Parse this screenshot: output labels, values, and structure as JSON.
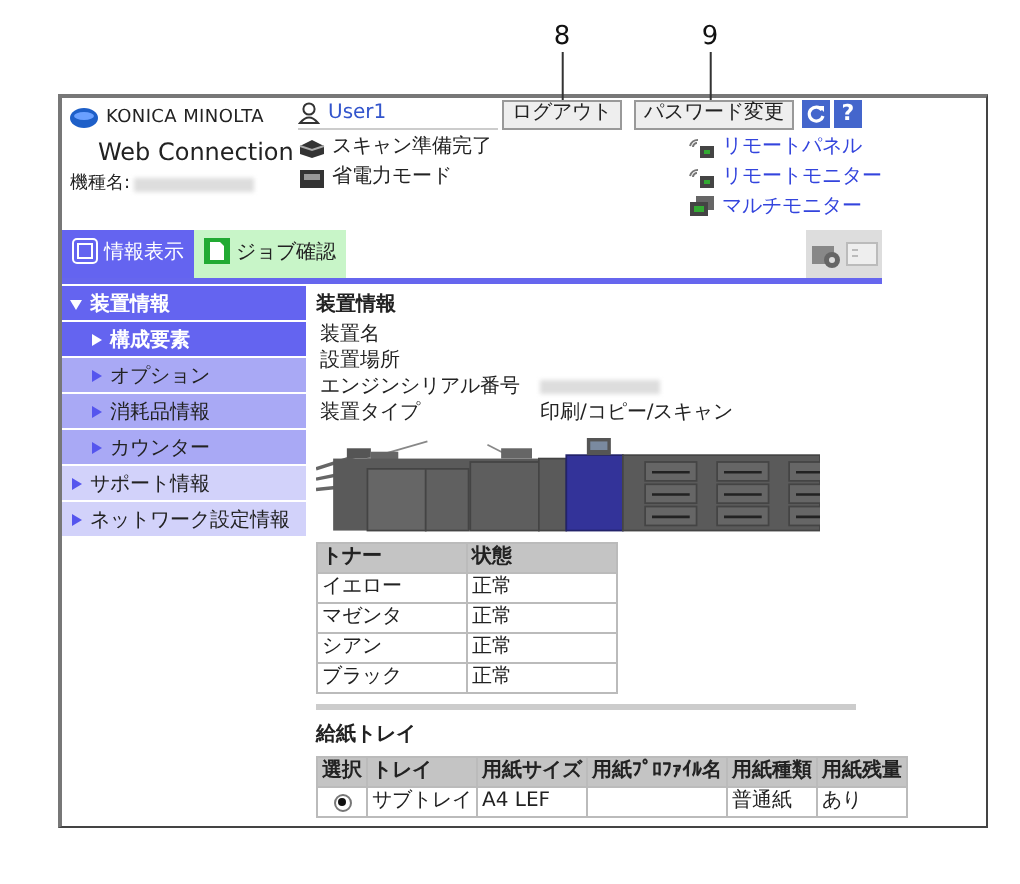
{
  "callouts": [
    "8",
    "9"
  ],
  "header": {
    "brand": "KONICA MINOLTA",
    "product": "Web Connection",
    "model_label": "機種名:",
    "model_redacted": true,
    "user": "User1",
    "status": [
      {
        "kind": "scan",
        "text": "スキャン準備完了"
      },
      {
        "kind": "power",
        "text": "省電力モード"
      }
    ],
    "buttons": [
      "ログアウト",
      "パスワード変更"
    ],
    "help": "?",
    "links": [
      {
        "kind": "remote",
        "text": "リモートパネル"
      },
      {
        "kind": "remote",
        "text": "リモートモニター"
      },
      {
        "kind": "multi",
        "text": "マルチモニター"
      }
    ]
  },
  "tabs": [
    {
      "label": "情報表示",
      "selected": true
    },
    {
      "label": "ジョブ確認",
      "selected": false
    }
  ],
  "sidebar": [
    {
      "label": "装置情報",
      "expanded": true,
      "children": [
        {
          "label": "構成要素",
          "selected": true
        },
        {
          "label": "オプション",
          "selected": false
        },
        {
          "label": "消耗品情報",
          "selected": false
        },
        {
          "label": "カウンター",
          "selected": false
        }
      ]
    },
    {
      "label": "サポート情報",
      "expanded": false
    },
    {
      "label": "ネットワーク設定情報",
      "expanded": false
    }
  ],
  "device_info": {
    "title": "装置情報",
    "rows": [
      {
        "label": "装置名"
      },
      {
        "label": "設置場所"
      },
      {
        "label": "エンジンシリアル番号",
        "redacted": true
      },
      {
        "label": "装置タイプ",
        "value": "印刷/コピー/スキャン"
      }
    ]
  },
  "toner": {
    "columns": [
      "トナー",
      "状態"
    ],
    "rows": [
      [
        "イエロー",
        "正常"
      ],
      [
        "マゼンタ",
        "正常"
      ],
      [
        "シアン",
        "正常"
      ],
      [
        "ブラック",
        "正常"
      ]
    ]
  },
  "paper_trays": {
    "title": "給紙トレイ",
    "columns": [
      "選択",
      "トレイ",
      "用紙サイズ",
      "用紙ﾌﾟﾛﾌｧｲﾙ名",
      "用紙種類",
      "用紙残量"
    ],
    "rows": [
      {
        "selected": true,
        "tray": "サブトレイ",
        "size": "A4 LEF",
        "type": "普通紙",
        "remaining": "あり"
      }
    ]
  }
}
